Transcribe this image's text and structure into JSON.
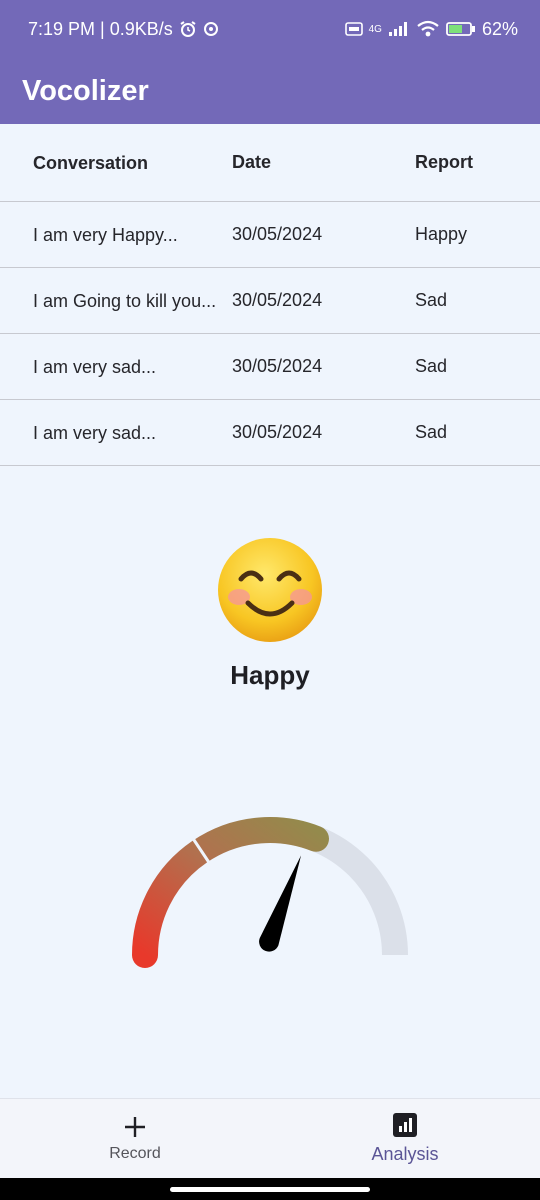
{
  "status_bar": {
    "time_info": "7:19 PM | 0.9KB/s",
    "network_label": "4G",
    "battery": "62%"
  },
  "app_bar": {
    "title": "Vocolizer"
  },
  "table": {
    "headers": {
      "conversation": "Conversation",
      "date": "Date",
      "report": "Report"
    },
    "rows": [
      {
        "conversation": "I am very Happy...",
        "date": "30/05/2024",
        "report": "Happy"
      },
      {
        "conversation": "I am Going to kill you...",
        "date": "30/05/2024",
        "report": "Sad"
      },
      {
        "conversation": "I am very sad...",
        "date": "30/05/2024",
        "report": "Sad"
      },
      {
        "conversation": "I am very sad...",
        "date": "30/05/2024",
        "report": "Sad"
      }
    ]
  },
  "mood": {
    "emoji_icon": "smiling-face-icon",
    "label": "Happy"
  },
  "gauge": {
    "level": 0.62,
    "colors": {
      "start": "#e8392b",
      "mid": "#b2704e",
      "end": "#948a4c",
      "track": "#dbe0e9"
    }
  },
  "bottom_nav": {
    "record_label": "Record",
    "analysis_label": "Analysis"
  },
  "colors": {
    "accent": "#7369b8",
    "background": "#eff5fd"
  }
}
